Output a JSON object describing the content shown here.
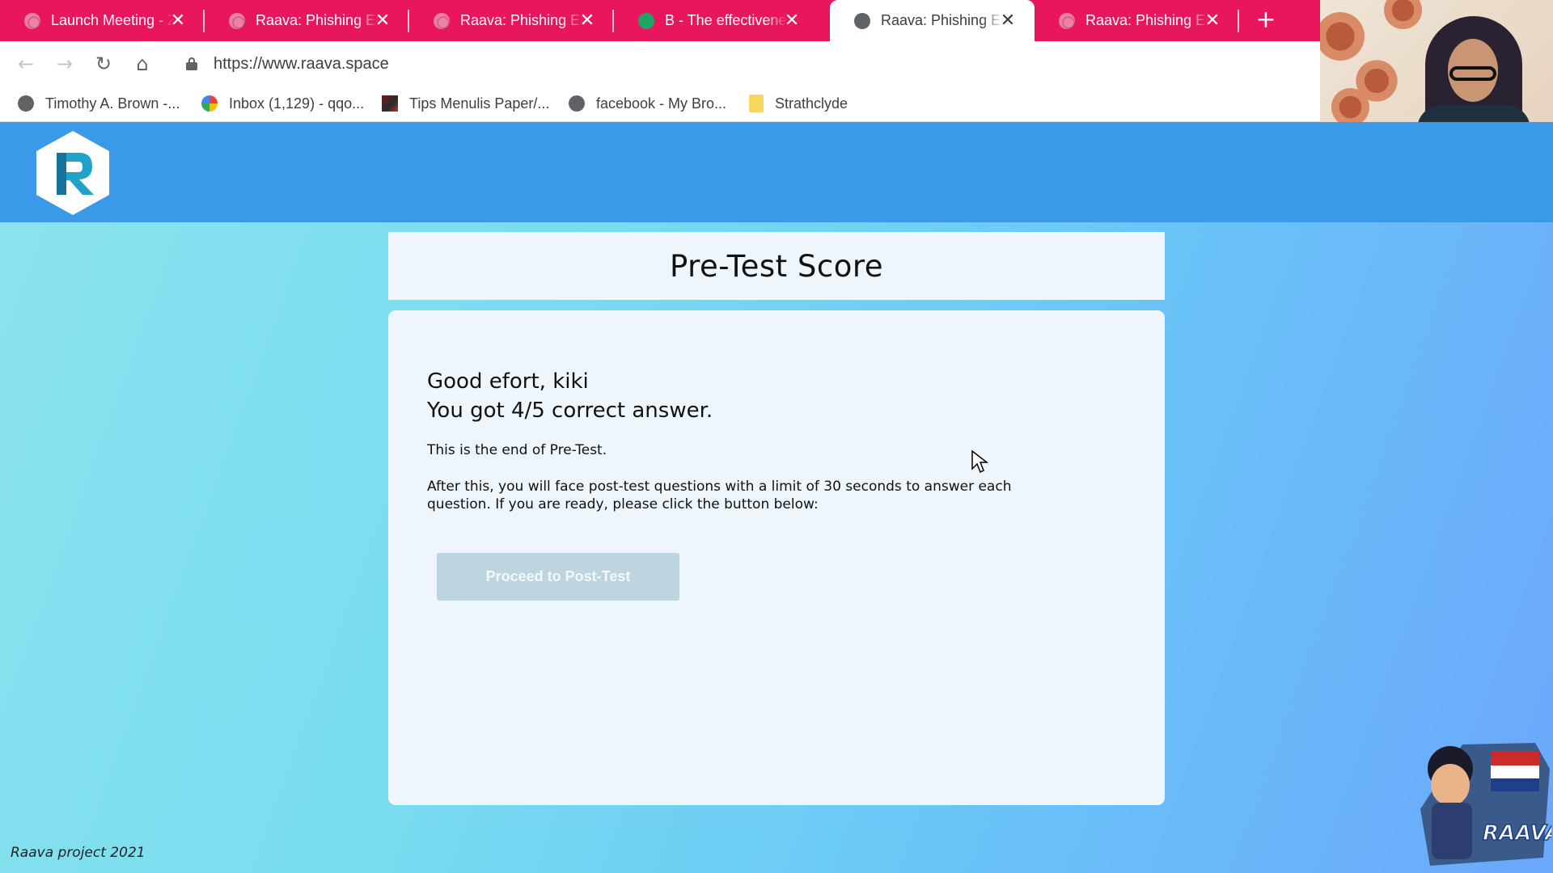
{
  "browser": {
    "tabs": [
      {
        "title": "Launch Meeting - Zoom",
        "icon": "globe-icon",
        "active": false
      },
      {
        "title": "Raava: Phishing Email",
        "icon": "globe-icon",
        "active": false
      },
      {
        "title": "Raava: Phishing Email",
        "icon": "globe-icon",
        "active": false
      },
      {
        "title": "B - The effectiveness",
        "icon": "cloud-icon",
        "active": false
      },
      {
        "title": "Raava: Phishing Email",
        "icon": "globe-icon",
        "active": true
      },
      {
        "title": "Raava: Phishing Email",
        "icon": "globe-icon",
        "active": false
      }
    ],
    "url": "https://www.raava.space",
    "bookmarks": [
      {
        "label": "Timothy A. Brown -...",
        "icon": "globe-icon"
      },
      {
        "label": "Inbox (1,129) - qqo...",
        "icon": "google-icon"
      },
      {
        "label": "Tips Menulis Paper/...",
        "icon": "image-icon"
      },
      {
        "label": "facebook - My Bro...",
        "icon": "globe-icon"
      },
      {
        "label": "Strathclyde",
        "icon": "folder-icon"
      }
    ],
    "colors": {
      "tabbar": "#e8175d"
    }
  },
  "page": {
    "title": "Pre-Test Score",
    "greeting_line1": "Good efort, kiki",
    "greeting_line2": "You got 4/5 correct answer.",
    "end_text": "This is the end of Pre-Test.",
    "info_text": "After this, you will face post-test questions with a limit of 30 seconds to answer each question. If you are ready, please click the button below:",
    "proceed_button": "Proceed to Post-Test",
    "footer": "Raava project 2021",
    "colors": {
      "header": "#3a9ae8",
      "card": "#eef6fc",
      "button": "#bcd5e0"
    }
  }
}
